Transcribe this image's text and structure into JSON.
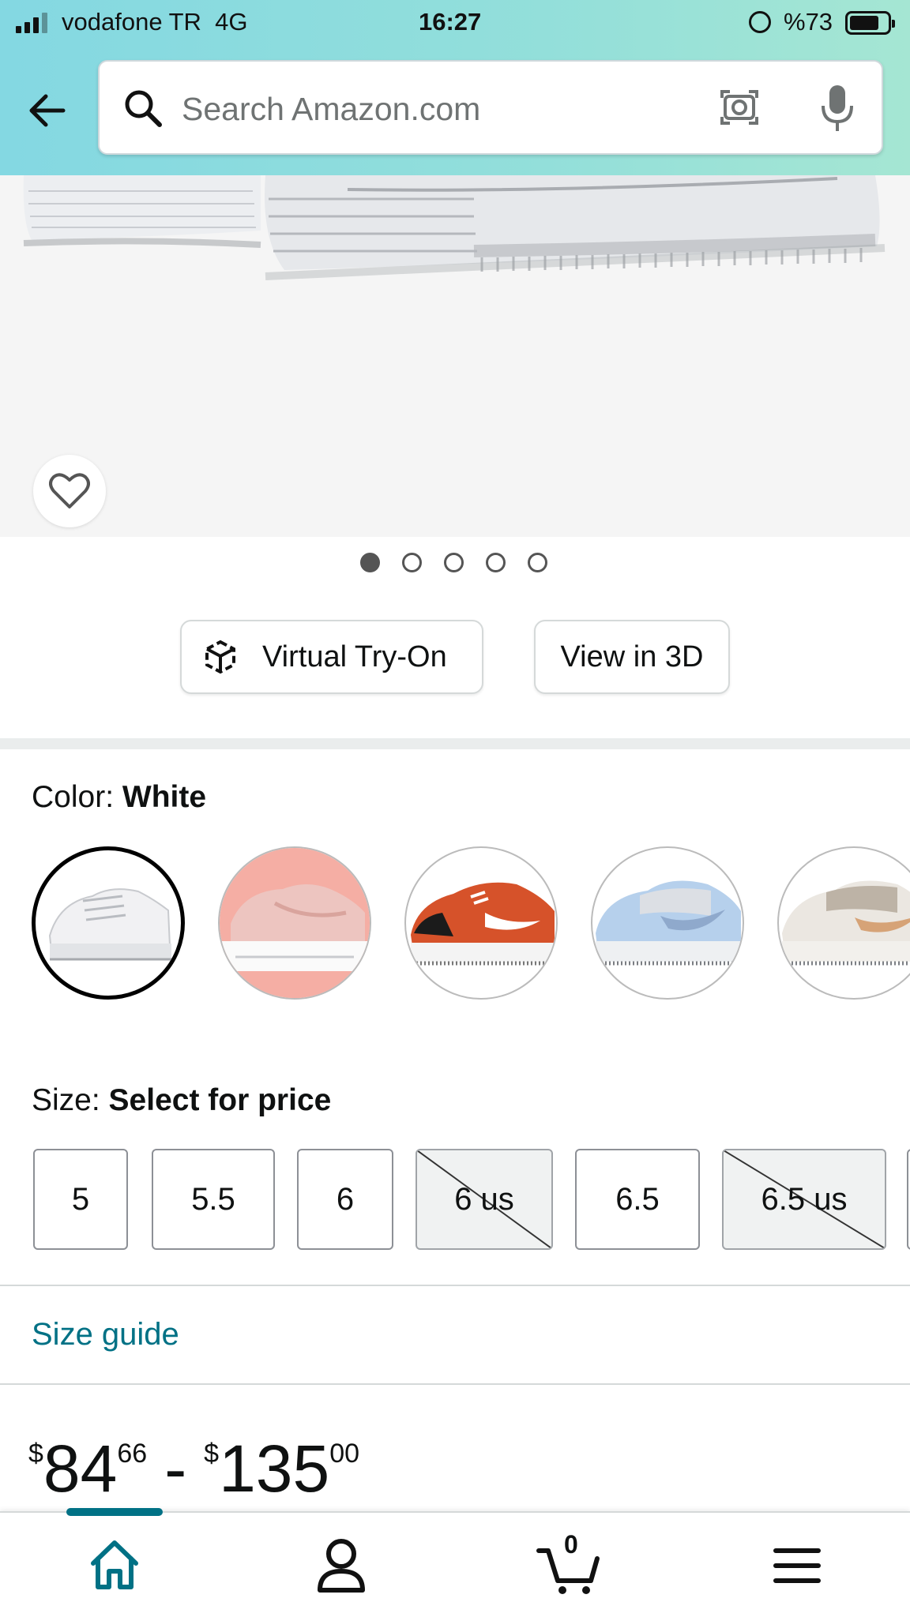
{
  "status_bar": {
    "carrier": "vodafone TR",
    "network": "4G",
    "time": "16:27",
    "battery": "%73",
    "battery_level": 0.73
  },
  "search": {
    "placeholder": "Search Amazon.com"
  },
  "gallery": {
    "total_images": 5,
    "active_index": 0
  },
  "actions": {
    "virtual_try_on": "Virtual Try-On",
    "view_in_3d": "View in 3D"
  },
  "color": {
    "label": "Color:",
    "selected": "White",
    "swatches": [
      {
        "name": "white",
        "bg": "#ffffff",
        "shoe": "#f0f0f2"
      },
      {
        "name": "pink",
        "bg": "#f7b1a8",
        "shoe": "#efc6c0"
      },
      {
        "name": "orange",
        "bg": "#ffffff",
        "shoe": "#d9562c"
      },
      {
        "name": "light-blue",
        "bg": "#ffffff",
        "shoe": "#b7d0ea"
      },
      {
        "name": "beige",
        "bg": "#ffffff",
        "shoe": "#e9e4dc"
      }
    ]
  },
  "size": {
    "label": "Size:",
    "selected": "Select for price",
    "options": [
      {
        "label": "5",
        "available": true
      },
      {
        "label": "5.5",
        "available": true
      },
      {
        "label": "6",
        "available": true
      },
      {
        "label": "6 us",
        "available": false
      },
      {
        "label": "6.5",
        "available": true
      },
      {
        "label": "6.5 us",
        "available": false
      }
    ]
  },
  "size_guide": "Size guide",
  "price": {
    "low_symbol": "$",
    "low_whole": "84",
    "low_fraction": "66",
    "separator": "-",
    "high_symbol": "$",
    "high_whole": "135",
    "high_fraction": "00"
  },
  "bottom_nav": {
    "cart_count": "0",
    "active": "home"
  },
  "colors": {
    "link": "#007185",
    "accent": "#007185"
  }
}
